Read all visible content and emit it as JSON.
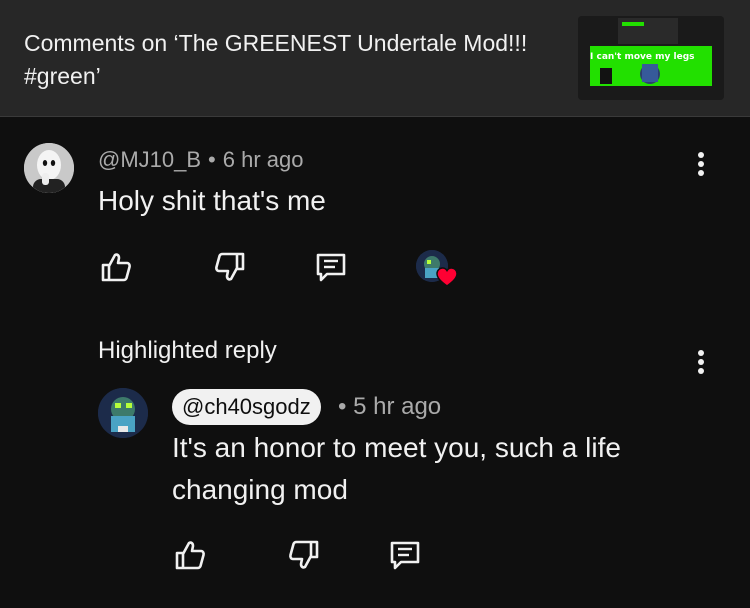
{
  "header": {
    "title": "Comments on ‘The GREENEST Undertale Mod!!! #green’",
    "thumbnail_caption": "I can't move my legs"
  },
  "comment": {
    "author": "@MJ10_B",
    "separator": "•",
    "time": "6 hr ago",
    "text": "Holy shit that's me",
    "creator_hearted": true
  },
  "highlighted_label": "Highlighted reply",
  "reply": {
    "author": "@ch40sgodz",
    "separator": "•",
    "time": "5 hr ago",
    "text": "It's an honor to meet you, such a life changing mod"
  },
  "icons": {
    "like": "thumbs-up-icon",
    "dislike": "thumbs-down-icon",
    "reply": "comment-icon",
    "more": "more-vert-icon",
    "heart": "heart-icon"
  },
  "colors": {
    "background": "#0f0f0f",
    "header": "#272727",
    "text": "#f1f1f1",
    "secondary_text": "#aaaaaa",
    "heart": "#ff0033",
    "thumbnail_green": "#22e000"
  }
}
